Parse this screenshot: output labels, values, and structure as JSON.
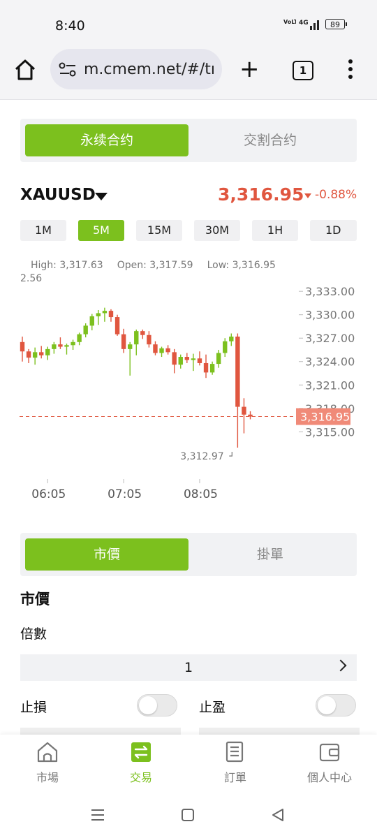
{
  "status_bar": {
    "time": "8:40",
    "network": "4G",
    "network_sub": "VoLTE",
    "battery": "89"
  },
  "browser": {
    "url": "m.cmem.net/#/tı",
    "tab_count": "1",
    "icons": [
      "home-icon",
      "site-settings-icon",
      "plus-icon",
      "tabs-icon",
      "more-vert-icon"
    ]
  },
  "contract_tabs": {
    "perpetual": "永续合约",
    "delivery": "交割合约"
  },
  "symbol": {
    "name": "XAUUSD",
    "price": "3,316.95",
    "change": "-0.88%",
    "change_direction": "down"
  },
  "intervals": [
    "1M",
    "5M",
    "15M",
    "30M",
    "1H",
    "1D"
  ],
  "active_interval": "5M",
  "ohlc": {
    "high": "High: 3,317.63",
    "open": "Open: 3,317.59",
    "low": "Low: 3,316.95",
    "left_fragment": "2.56"
  },
  "colors": {
    "accent": "#7cc01e",
    "up": "#7cc01e",
    "down": "#e0563f",
    "annotation": "#e0101a"
  },
  "chart_data": {
    "type": "candlestick",
    "y_ticks": [
      "3,333.00",
      "3,330.00",
      "3,327.00",
      "3,324.00",
      "3,321.00",
      "3,318.00",
      "3,315.00"
    ],
    "ylim": [
      3311,
      3334
    ],
    "x_ticks": [
      {
        "label": "06:05",
        "index": 4
      },
      {
        "label": "07:05",
        "index": 16
      },
      {
        "label": "08:05",
        "index": 28
      }
    ],
    "last_price_label": "3,316.95",
    "last_price": 3316.95,
    "low_marker": {
      "label": "3,312.97",
      "index": 33,
      "value": 3312.97
    },
    "candles": [
      [
        3326.5,
        3327.2,
        3324.0,
        3325.3
      ],
      [
        3325.3,
        3325.6,
        3323.8,
        3324.5
      ],
      [
        3324.5,
        3325.8,
        3323.6,
        3325.2
      ],
      [
        3325.2,
        3326.0,
        3324.4,
        3324.8
      ],
      [
        3324.8,
        3325.9,
        3324.2,
        3325.6
      ],
      [
        3325.6,
        3326.5,
        3325.0,
        3326.2
      ],
      [
        3326.2,
        3327.1,
        3325.6,
        3325.9
      ],
      [
        3325.9,
        3326.3,
        3324.9,
        3326.1
      ],
      [
        3326.1,
        3326.8,
        3325.5,
        3326.5
      ],
      [
        3326.5,
        3327.7,
        3326.1,
        3327.5
      ],
      [
        3327.5,
        3328.9,
        3327.1,
        3328.6
      ],
      [
        3328.6,
        3330.1,
        3328.0,
        3329.8
      ],
      [
        3329.8,
        3330.6,
        3328.7,
        3330.2
      ],
      [
        3330.2,
        3330.9,
        3329.1,
        3330.5
      ],
      [
        3330.5,
        3330.7,
        3329.1,
        3329.7
      ],
      [
        3329.7,
        3330.0,
        3327.3,
        3327.5
      ],
      [
        3327.5,
        3328.2,
        3325.1,
        3325.6
      ],
      [
        3325.6,
        3326.5,
        3322.2,
        3326.2
      ],
      [
        3326.2,
        3328.1,
        3324.8,
        3327.9
      ],
      [
        3327.9,
        3328.1,
        3326.9,
        3327.4
      ],
      [
        3327.4,
        3327.9,
        3325.8,
        3326.2
      ],
      [
        3326.2,
        3326.6,
        3324.8,
        3325.1
      ],
      [
        3325.1,
        3325.9,
        3324.6,
        3325.7
      ],
      [
        3325.7,
        3326.1,
        3324.9,
        3325.2
      ],
      [
        3325.2,
        3325.6,
        3322.5,
        3323.6
      ],
      [
        3323.6,
        3324.9,
        3323.1,
        3324.6
      ],
      [
        3324.6,
        3325.1,
        3323.8,
        3324.2
      ],
      [
        3324.2,
        3325.0,
        3322.8,
        3324.4
      ],
      [
        3324.4,
        3325.3,
        3323.5,
        3323.8
      ],
      [
        3323.8,
        3324.9,
        3321.9,
        3322.6
      ],
      [
        3322.6,
        3324.0,
        3322.3,
        3323.7
      ],
      [
        3323.7,
        3325.5,
        3323.2,
        3325.1
      ],
      [
        3325.1,
        3327.0,
        3324.6,
        3326.6
      ],
      [
        3326.6,
        3327.6,
        3326.0,
        3327.2
      ],
      [
        3327.2,
        3327.6,
        3312.97,
        3318.2
      ],
      [
        3318.2,
        3319.3,
        3314.8,
        3317.2
      ],
      [
        3317.2,
        3317.63,
        3316.6,
        3316.95
      ]
    ]
  },
  "order_tabs": {
    "market": "市價",
    "limit": "掛單"
  },
  "order_form": {
    "section_title": "市價",
    "leverage_label": "倍數",
    "leverage_value": "1",
    "stop_loss_label": "止損",
    "take_profit_label": "止盈"
  },
  "bottom_nav": [
    {
      "label": "市場",
      "icon": "market-home-icon"
    },
    {
      "label": "交易",
      "icon": "trade-swap-icon",
      "active": true
    },
    {
      "label": "訂單",
      "icon": "orders-icon"
    },
    {
      "label": "個人中心",
      "icon": "wallet-icon"
    }
  ],
  "system_nav": [
    "recents-icon",
    "home-square-icon",
    "back-triangle-icon"
  ]
}
